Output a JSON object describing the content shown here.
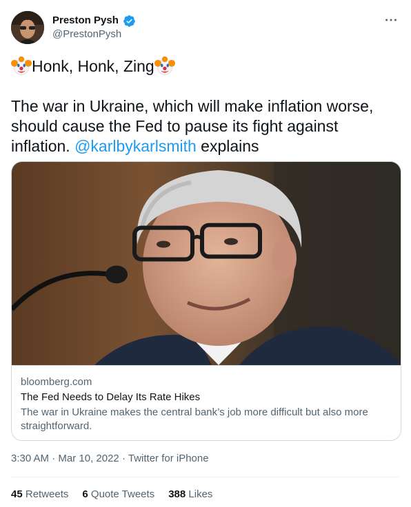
{
  "tweet": {
    "author": {
      "display_name": "Preston Pysh",
      "handle": "@PrestonPysh",
      "verified": true,
      "avatar_icon": "avatar-photo"
    },
    "more_icon": "more-options-icon",
    "line1_text": "Honk, Honk, Zing",
    "line1_emoji": "clown-face",
    "body_prefix": "The war in Ukraine, which will make inflation worse, should cause the Fed to pause its fight against inflation. ",
    "mention": "@karlbykarlsmith",
    "body_suffix": " explains",
    "card": {
      "domain": "bloomberg.com",
      "title": "The Fed Needs to Delay Its Rate Hikes",
      "description": "The war in Ukraine makes the central bank’s job more difficult but also more straightforward."
    },
    "time": "3:30 AM",
    "date": "Mar 10, 2022",
    "source": "Twitter for iPhone",
    "separator": "·",
    "stats": {
      "retweets_count": "45",
      "retweets_label": "Retweets",
      "quotes_count": "6",
      "quotes_label": "Quote Tweets",
      "likes_count": "388",
      "likes_label": "Likes"
    }
  },
  "colors": {
    "link": "#1d9bf0",
    "secondary_text": "#536471",
    "primary_text": "#0f1419",
    "border": "#cfd9de"
  }
}
